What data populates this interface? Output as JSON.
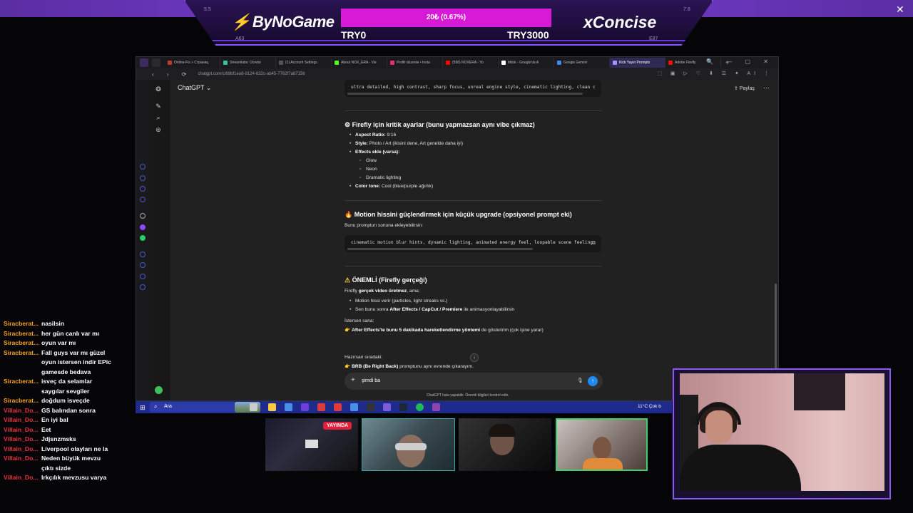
{
  "overlay": {
    "brand_left": "ByNoGame",
    "brand_right": "xConcise",
    "goal_text": "20₺ (0.67%)",
    "goal_progress": 0.0067,
    "goal_min": "TRY0",
    "goal_max": "TRY3000",
    "corner_tl": "5.5",
    "corner_tr": "7.8",
    "corner_bl": "A63",
    "corner_br": "E87",
    "close": "✕"
  },
  "browser": {
    "tabs": [
      {
        "label": "Online-Fix » Страниц",
        "color": "#c0392b"
      },
      {
        "label": "Streamlabs: Ücretsi",
        "color": "#31c3a2"
      },
      {
        "label": "(1) Account Settings",
        "color": "#555555"
      },
      {
        "label": "About NOX_ERA - Vie",
        "color": "#53fc18"
      },
      {
        "label": "Profili düzenle • Insta",
        "color": "#e1306c"
      },
      {
        "label": "(598) NOXERA - Yo",
        "color": "#ff0000"
      },
      {
        "label": "tiktok - Google'da A",
        "color": "#ffffff"
      },
      {
        "label": "Google Gemini",
        "color": "#4285f4"
      },
      {
        "label": "Kick Yayın Prompts",
        "color": "#a98bff",
        "active": true
      },
      {
        "label": "Adobe Firefly",
        "color": "#eb1000"
      }
    ],
    "new_tab": "+",
    "url": "chatgpt.com/c/69bf1ea6-9124-832c-ab45-7762f7a87156",
    "nav": "‹ ›  ⟳"
  },
  "chatgpt": {
    "model": "ChatGPT",
    "model_chevron": "⌄",
    "share_label": "Paylaş",
    "share_icon": "upload-icon",
    "more": "⋯",
    "code_top": "ultra detailed, high contrast, sharp focus, unreal engine style, cinematic lighting, clean c",
    "section1": {
      "emoji": "⚙",
      "title": "Firefly için kritik ayarlar (bunu yapmazsan aynı vibe çıkmaz)",
      "items": [
        {
          "label": "Aspect Ratio:",
          "value": " 9:16"
        },
        {
          "label": "Style:",
          "value": " Photo / Art (ikisini dene, Art genelde daha iyi)"
        },
        {
          "label": "Effects ekle (varsa):",
          "value": ""
        }
      ],
      "sub_items": [
        "Glow",
        "Neon",
        "Dramatic lighting"
      ],
      "last": {
        "label": "Color tone:",
        "value": " Cool (blue/purple ağırlık)"
      }
    },
    "section2": {
      "emoji": "🔥",
      "title": "Motion hissini güçlendirmek için küçük upgrade (opsiyonel prompt eki)",
      "intro": "Bunu promptun sonuna ekleyebilirsin:",
      "code": "cinematic motion blur hints, dynamic lighting, animated energy feel, loopable scene feeling"
    },
    "section3": {
      "emoji": "⚠",
      "title": "ÖNEMLİ (Firefly gerçeği)",
      "line1_pre": "Firefly ",
      "line1_bold": "gerçek video üretmez",
      "line1_post": ", ama:",
      "bullet1": "Motion hissi verir (particles, light streaks vs.)",
      "bullet2_pre": "Sen bunu sonra ",
      "bullet2_bold": "After Effects / CapCut / Premiere",
      "bullet2_post": " ile animasyonlayabilirsin",
      "ask": "İstersen sana:",
      "offer_bold": "After Effects'te bunu 5 dakikada hareketlendirme yöntemi",
      "offer_post": " de gösteririm (çok işine yarar)"
    },
    "next_intro": "Hazırsan sıradaki:",
    "next_bold": "BRB (Be Right Back)",
    "next_post": " promptunu aynı evrende çıkarayım.",
    "pointer_emoji": "👉",
    "composer_text": "şimdi ba",
    "disclaimer": "ChatGPT hata yapabilir. Önemli bilgileri kontrol edin."
  },
  "taskbar": {
    "search_label": "Ara",
    "tray_text": "11°C  Çok b"
  },
  "chat": [
    {
      "user": "Siracberat...",
      "msg": "nasilsin",
      "color": "orange"
    },
    {
      "user": "Siracberat...",
      "msg": "her gün canlı var mı",
      "color": "orange"
    },
    {
      "user": "Siracberat...",
      "msg": "oyun var mı",
      "color": "orange"
    },
    {
      "user": "Siracberat...",
      "msg": "Fall guys var mı güzel oyun istersen indir EPic gamesde bedava",
      "color": "orange"
    },
    {
      "user": "Siracberat...",
      "msg": "isveç da selamlar saygılar sevgiler",
      "color": "orange"
    },
    {
      "user": "Siracberat...",
      "msg": "doğdum isveçde",
      "color": "orange"
    },
    {
      "user": "Villain_Do...",
      "msg": "GS balından sonra",
      "color": "red"
    },
    {
      "user": "Villain_Do...",
      "msg": "En iyi bal",
      "color": "red"
    },
    {
      "user": "Villain_Do...",
      "msg": "Eet",
      "color": "red"
    },
    {
      "user": "Villain_Do...",
      "msg": "Jdjsnzmsks",
      "color": "red"
    },
    {
      "user": "Villain_Do...",
      "msg": "Liverpool olayları ne la",
      "color": "red"
    },
    {
      "user": "Villain_Do...",
      "msg": "Neden büyük mevzu çıktı sizde",
      "color": "red"
    },
    {
      "user": "Villain_Do...",
      "msg": "Irkçılık mevzusu varya",
      "color": "red"
    }
  ],
  "cams": {
    "live_badge": "YAYINDA"
  }
}
